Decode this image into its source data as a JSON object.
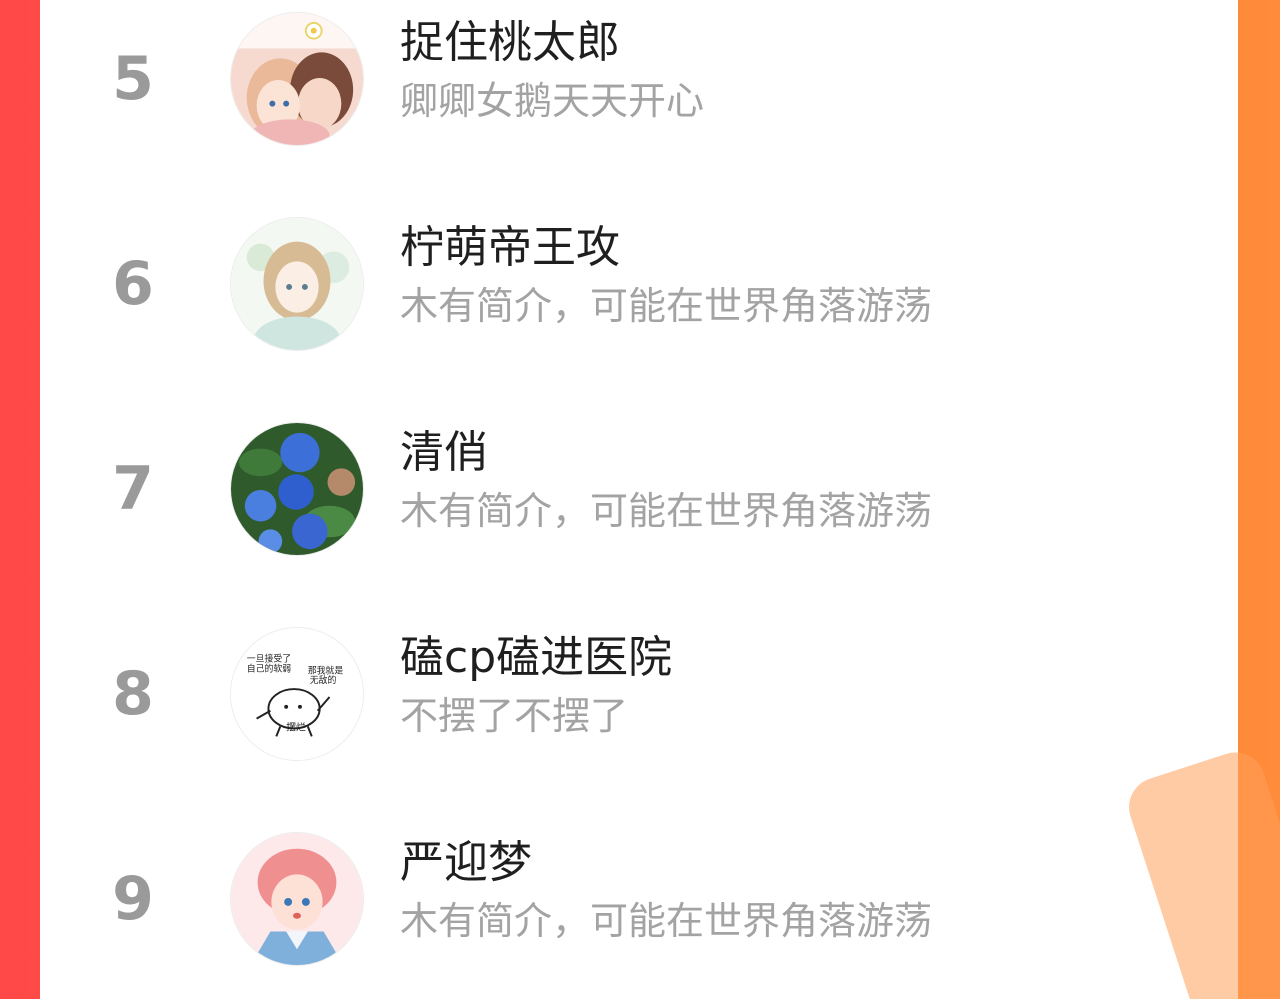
{
  "list": {
    "items": [
      {
        "rank": "5",
        "name": "捉住桃太郎",
        "bio": "卿卿女鹅天天开心",
        "avatar_icon": "anime-couple-avatar"
      },
      {
        "rank": "6",
        "name": "柠萌帝王攻",
        "bio": "木有简介，可能在世界角落游荡",
        "avatar_icon": "anime-girl-avatar"
      },
      {
        "rank": "7",
        "name": "清俏",
        "bio": "木有简介，可能在世界角落游荡",
        "avatar_icon": "hydrangea-flowers-avatar"
      },
      {
        "rank": "8",
        "name": "磕cp磕进医院",
        "bio": "不摆了不摆了",
        "avatar_icon": "meme-bear-avatar"
      },
      {
        "rank": "9",
        "name": "严迎梦",
        "bio": "木有简介，可能在世界角落游荡",
        "avatar_icon": "anime-boy-avatar"
      }
    ]
  },
  "avatar_meme": {
    "text_left": "一旦接受了\n自己的软弱",
    "text_right": "那我就是\n无敌的",
    "caption": "摆烂"
  },
  "colors": {
    "background_gradient_start": "#ff4848",
    "background_gradient_end": "#ff8c3a",
    "rank_color": "#9a9a9a",
    "name_color": "#1f1f1f",
    "bio_color": "#a3a3a3"
  }
}
